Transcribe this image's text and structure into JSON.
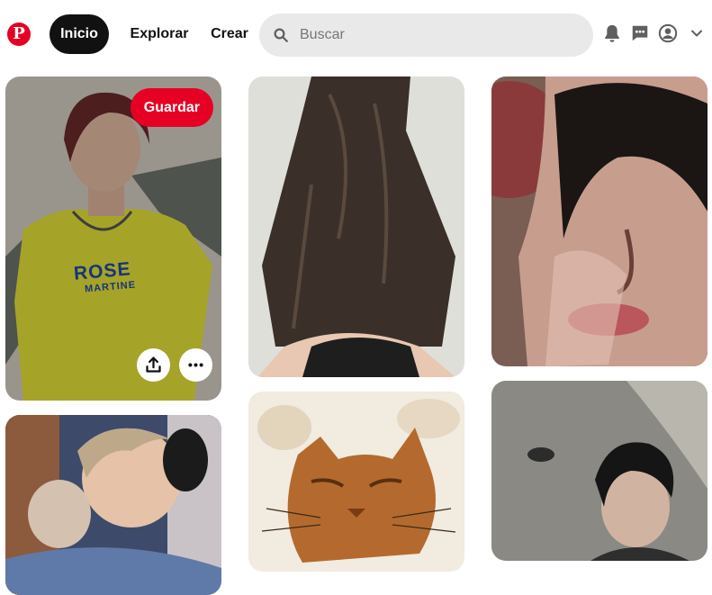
{
  "header": {
    "logo_letter": "P",
    "nav": {
      "home": "Inicio",
      "explore": "Explorar",
      "create": "Crear"
    },
    "search": {
      "placeholder": "Buscar",
      "value": ""
    },
    "icons": [
      "bell-icon",
      "message-icon",
      "account-icon",
      "chevron-down-icon"
    ]
  },
  "pins": {
    "hover_pin": {
      "save_label": "Guardar",
      "shirt_text": "ROSE",
      "shirt_subtext": "MARTINE",
      "actions": [
        "share-icon",
        "more-icon"
      ]
    }
  },
  "colors": {
    "brand": "#e60023",
    "active_nav": "#111111",
    "search_bg": "#e9e9e9"
  }
}
